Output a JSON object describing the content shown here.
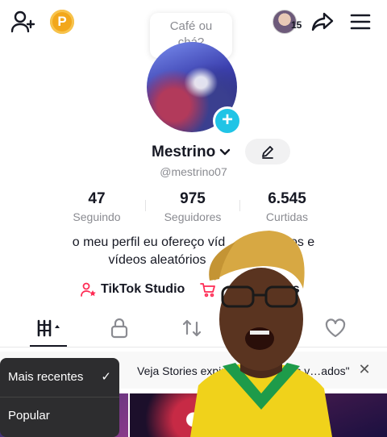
{
  "topbar": {
    "coin_letter": "P",
    "bubble_text": "Café ou chá?",
    "visitor_count": "15"
  },
  "profile": {
    "display_name": "Mestrino",
    "handle": "@mestrino07",
    "bio": "o meu perfil eu ofereço víd...cados e vídeos aleatórios",
    "bio_line1": "o meu perfil eu ofereço víd",
    "bio_line1b": "cados e",
    "bio_line2": "vídeos aleatórios"
  },
  "stats": [
    {
      "value": "47",
      "label": "Seguindo"
    },
    {
      "value": "975",
      "label": "Seguidores"
    },
    {
      "value": "6.545",
      "label": "Curtidas"
    }
  ],
  "links": {
    "studio": "TikTok Studio",
    "shop": "os"
  },
  "banner": {
    "text": "Veja Stories expirados em \"Seus v…ados\""
  },
  "sort_menu": {
    "items": [
      "Mais recentes",
      "Popular"
    ],
    "check": "✓"
  },
  "colors": {
    "accent": "#20c4e6",
    "coin": "#f2a71b",
    "studio_icon": "#fe2c55",
    "muted": "#8a8b91"
  }
}
